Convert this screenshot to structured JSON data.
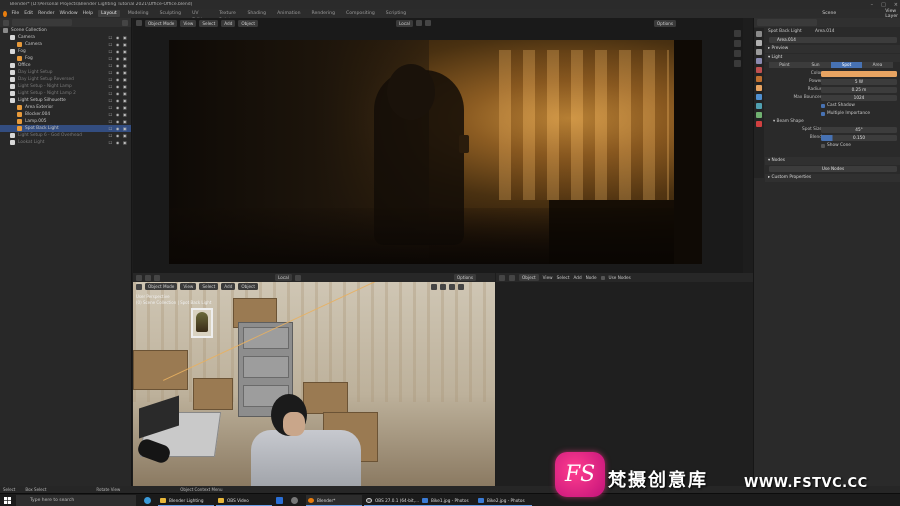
{
  "window": {
    "title": "Blender* [D:\\Personal Projects\\Blender Lighting Tutorial 2021\\Office-Office.blend]",
    "controls": [
      "–",
      "□",
      "×"
    ]
  },
  "menubar": {
    "logo_icon": "blender-logo-icon",
    "menus": [
      "File",
      "Edit",
      "Render",
      "Window",
      "Help"
    ],
    "workspaces": [
      "Layout",
      "Modeling",
      "Sculpting",
      "UV Editing",
      "Texture Paint",
      "Shading",
      "Animation",
      "Rendering",
      "Compositing",
      "Scripting"
    ],
    "active_workspace": "Layout",
    "scene_label": "Scene",
    "view_layer_label": "View Layer"
  },
  "outliner": {
    "items": [
      {
        "label": "Scene Collection",
        "depth": 0,
        "color": "#9a9a9a",
        "state": "normal"
      },
      {
        "label": "Camera",
        "depth": 1,
        "color": "#d0d0d0",
        "state": "normal"
      },
      {
        "label": "Camera",
        "depth": 2,
        "color": "#e89a3a",
        "state": "normal"
      },
      {
        "label": "Fog",
        "depth": 1,
        "color": "#d0d0d0",
        "state": "normal"
      },
      {
        "label": "Fog",
        "depth": 2,
        "color": "#e89a3a",
        "state": "normal"
      },
      {
        "label": "Office",
        "depth": 1,
        "color": "#d0d0d0",
        "state": "normal"
      },
      {
        "label": "Day Light Setup",
        "depth": 1,
        "color": "#d0d0d0",
        "state": "dim"
      },
      {
        "label": "Day Light Setup Reversed",
        "depth": 1,
        "color": "#d0d0d0",
        "state": "dim"
      },
      {
        "label": "Light Setup - Night Lamp",
        "depth": 1,
        "color": "#d0d0d0",
        "state": "dim"
      },
      {
        "label": "Light Setup - Night Lamp 2",
        "depth": 1,
        "color": "#d0d0d0",
        "state": "dim"
      },
      {
        "label": "Light Setup Silhouette",
        "depth": 1,
        "color": "#d0d0d0",
        "state": "normal"
      },
      {
        "label": "Area Exterior",
        "depth": 2,
        "color": "#e89a3a",
        "state": "normal"
      },
      {
        "label": "Blocker.004",
        "depth": 2,
        "color": "#e89a3a",
        "state": "normal"
      },
      {
        "label": "Lamp.005",
        "depth": 2,
        "color": "#e89a3a",
        "state": "normal"
      },
      {
        "label": "Spot Back Light",
        "depth": 2,
        "color": "#e89a3a",
        "state": "selected"
      },
      {
        "label": "Light Setup 6 - God Overhead",
        "depth": 1,
        "color": "#d0d0d0",
        "state": "dim"
      },
      {
        "label": "Lookat Light",
        "depth": 1,
        "color": "#d0d0d0",
        "state": "dim"
      }
    ],
    "vis_icons": "☐ ◉ ▣"
  },
  "viewport_top": {
    "mode": "Object Mode",
    "menus": [
      "View",
      "Select",
      "Add",
      "Object"
    ],
    "transform": "Local",
    "options": "Options"
  },
  "properties": {
    "object_name": "Spot Back Light",
    "data_name": "Area.014",
    "light_data_field": "Area.014",
    "sections": {
      "preview": "Preview",
      "light": "Light",
      "beam_shape": "Beam Shape",
      "nodes": "Nodes",
      "custom": "Custom Properties"
    },
    "light_types": [
      "Point",
      "Sun",
      "Spot",
      "Area"
    ],
    "active_light_type": "Spot",
    "fields": [
      {
        "label": "Color",
        "value": "",
        "kind": "color",
        "color": "#e8a462"
      },
      {
        "label": "Power",
        "value": "5 W",
        "kind": "num"
      },
      {
        "label": "Radius",
        "value": "0.25 m",
        "kind": "num"
      },
      {
        "label": "Max Bounces",
        "value": "1024",
        "kind": "num"
      }
    ],
    "checks": [
      {
        "label": "Cast Shadow",
        "on": true
      },
      {
        "label": "Multiple Importance",
        "on": true
      }
    ],
    "spot_fields": [
      {
        "label": "Spot Size",
        "value": "45°"
      },
      {
        "label": "Blend",
        "value": "0.150"
      }
    ],
    "show_cone": {
      "label": "Show Cone",
      "on": false
    },
    "use_nodes_button": "Use Nodes"
  },
  "viewport_bottom": {
    "mode": "Object Mode",
    "menus": [
      "View",
      "Select",
      "Add",
      "Object"
    ],
    "transform": "Local",
    "options": "Options",
    "overlay_text": [
      "User Perspective",
      "(0) Scene Collection | Spot Back Light"
    ]
  },
  "node_editor": {
    "object_label": "Object",
    "menus": [
      "View",
      "Select",
      "Add",
      "Node"
    ],
    "use_nodes": "Use Nodes"
  },
  "statusbar": {
    "items": [
      "Select",
      "Box Select",
      "Rotate View",
      "Object Context Menu"
    ]
  },
  "taskbar": {
    "search_placeholder": "Type here to search",
    "apps": [
      {
        "label": "Blender Lighting Tut...",
        "color": "#e8b73a"
      },
      {
        "label": "OBS Video",
        "color": "#e8b73a"
      },
      {
        "label": "Blender* [D:\\Person...",
        "color": "#e87d0d"
      },
      {
        "label": "OBS 27.0.1 (64-bit,...",
        "color": "#444"
      },
      {
        "label": "Bike1.jpg - Photos",
        "color": "#3a7bd5"
      },
      {
        "label": "Bike2.jpg - Photos",
        "color": "#3a7bd5"
      }
    ]
  },
  "watermark": {
    "logo_text": "FS",
    "chinese_text": "梵摄创意库",
    "url": "WWW.FSTVC.CC"
  }
}
